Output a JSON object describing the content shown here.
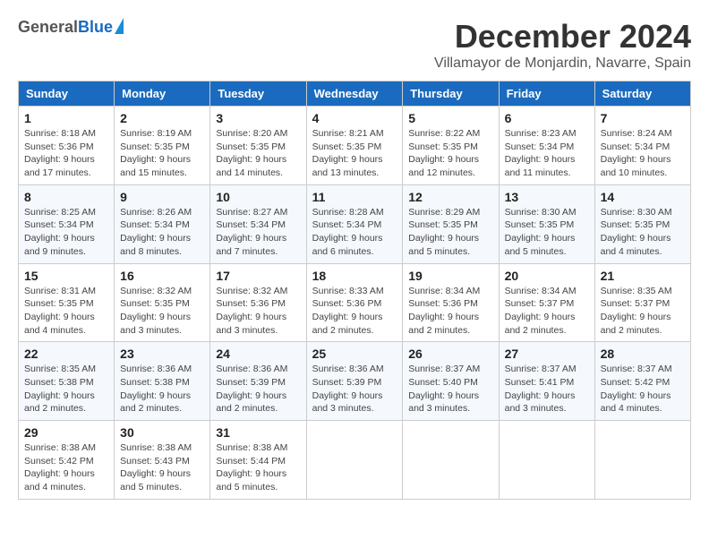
{
  "logo": {
    "general": "General",
    "blue": "Blue"
  },
  "title": {
    "month": "December 2024",
    "location": "Villamayor de Monjardin, Navarre, Spain"
  },
  "days_of_week": [
    "Sunday",
    "Monday",
    "Tuesday",
    "Wednesday",
    "Thursday",
    "Friday",
    "Saturday"
  ],
  "weeks": [
    [
      {
        "day": "1",
        "sunrise": "8:18 AM",
        "sunset": "5:36 PM",
        "daylight": "9 hours and 17 minutes."
      },
      {
        "day": "2",
        "sunrise": "8:19 AM",
        "sunset": "5:35 PM",
        "daylight": "9 hours and 15 minutes."
      },
      {
        "day": "3",
        "sunrise": "8:20 AM",
        "sunset": "5:35 PM",
        "daylight": "9 hours and 14 minutes."
      },
      {
        "day": "4",
        "sunrise": "8:21 AM",
        "sunset": "5:35 PM",
        "daylight": "9 hours and 13 minutes."
      },
      {
        "day": "5",
        "sunrise": "8:22 AM",
        "sunset": "5:35 PM",
        "daylight": "9 hours and 12 minutes."
      },
      {
        "day": "6",
        "sunrise": "8:23 AM",
        "sunset": "5:34 PM",
        "daylight": "9 hours and 11 minutes."
      },
      {
        "day": "7",
        "sunrise": "8:24 AM",
        "sunset": "5:34 PM",
        "daylight": "9 hours and 10 minutes."
      }
    ],
    [
      {
        "day": "8",
        "sunrise": "8:25 AM",
        "sunset": "5:34 PM",
        "daylight": "9 hours and 9 minutes."
      },
      {
        "day": "9",
        "sunrise": "8:26 AM",
        "sunset": "5:34 PM",
        "daylight": "9 hours and 8 minutes."
      },
      {
        "day": "10",
        "sunrise": "8:27 AM",
        "sunset": "5:34 PM",
        "daylight": "9 hours and 7 minutes."
      },
      {
        "day": "11",
        "sunrise": "8:28 AM",
        "sunset": "5:34 PM",
        "daylight": "9 hours and 6 minutes."
      },
      {
        "day": "12",
        "sunrise": "8:29 AM",
        "sunset": "5:35 PM",
        "daylight": "9 hours and 5 minutes."
      },
      {
        "day": "13",
        "sunrise": "8:30 AM",
        "sunset": "5:35 PM",
        "daylight": "9 hours and 5 minutes."
      },
      {
        "day": "14",
        "sunrise": "8:30 AM",
        "sunset": "5:35 PM",
        "daylight": "9 hours and 4 minutes."
      }
    ],
    [
      {
        "day": "15",
        "sunrise": "8:31 AM",
        "sunset": "5:35 PM",
        "daylight": "9 hours and 4 minutes."
      },
      {
        "day": "16",
        "sunrise": "8:32 AM",
        "sunset": "5:35 PM",
        "daylight": "9 hours and 3 minutes."
      },
      {
        "day": "17",
        "sunrise": "8:32 AM",
        "sunset": "5:36 PM",
        "daylight": "9 hours and 3 minutes."
      },
      {
        "day": "18",
        "sunrise": "8:33 AM",
        "sunset": "5:36 PM",
        "daylight": "9 hours and 2 minutes."
      },
      {
        "day": "19",
        "sunrise": "8:34 AM",
        "sunset": "5:36 PM",
        "daylight": "9 hours and 2 minutes."
      },
      {
        "day": "20",
        "sunrise": "8:34 AM",
        "sunset": "5:37 PM",
        "daylight": "9 hours and 2 minutes."
      },
      {
        "day": "21",
        "sunrise": "8:35 AM",
        "sunset": "5:37 PM",
        "daylight": "9 hours and 2 minutes."
      }
    ],
    [
      {
        "day": "22",
        "sunrise": "8:35 AM",
        "sunset": "5:38 PM",
        "daylight": "9 hours and 2 minutes."
      },
      {
        "day": "23",
        "sunrise": "8:36 AM",
        "sunset": "5:38 PM",
        "daylight": "9 hours and 2 minutes."
      },
      {
        "day": "24",
        "sunrise": "8:36 AM",
        "sunset": "5:39 PM",
        "daylight": "9 hours and 2 minutes."
      },
      {
        "day": "25",
        "sunrise": "8:36 AM",
        "sunset": "5:39 PM",
        "daylight": "9 hours and 3 minutes."
      },
      {
        "day": "26",
        "sunrise": "8:37 AM",
        "sunset": "5:40 PM",
        "daylight": "9 hours and 3 minutes."
      },
      {
        "day": "27",
        "sunrise": "8:37 AM",
        "sunset": "5:41 PM",
        "daylight": "9 hours and 3 minutes."
      },
      {
        "day": "28",
        "sunrise": "8:37 AM",
        "sunset": "5:42 PM",
        "daylight": "9 hours and 4 minutes."
      }
    ],
    [
      {
        "day": "29",
        "sunrise": "8:38 AM",
        "sunset": "5:42 PM",
        "daylight": "9 hours and 4 minutes."
      },
      {
        "day": "30",
        "sunrise": "8:38 AM",
        "sunset": "5:43 PM",
        "daylight": "9 hours and 5 minutes."
      },
      {
        "day": "31",
        "sunrise": "8:38 AM",
        "sunset": "5:44 PM",
        "daylight": "9 hours and 5 minutes."
      },
      null,
      null,
      null,
      null
    ]
  ]
}
